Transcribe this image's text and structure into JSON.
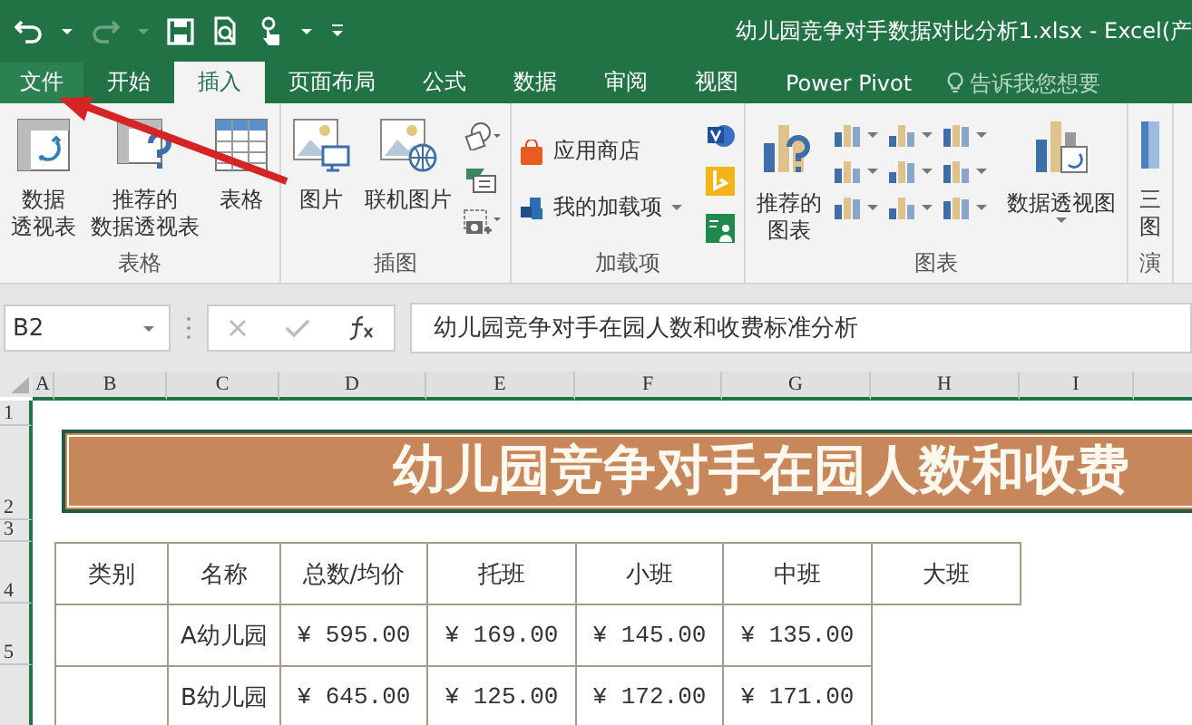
{
  "window": {
    "title": "幼儿园竞争对手数据对比分析1.xlsx - Excel(产"
  },
  "tabs": [
    {
      "label": "文件",
      "selected": false,
      "kind": "file"
    },
    {
      "label": "开始",
      "selected": false,
      "kind": "tab"
    },
    {
      "label": "插入",
      "selected": true,
      "kind": "tab"
    },
    {
      "label": "页面布局",
      "selected": false,
      "kind": "tab"
    },
    {
      "label": "公式",
      "selected": false,
      "kind": "tab"
    },
    {
      "label": "数据",
      "selected": false,
      "kind": "tab"
    },
    {
      "label": "审阅",
      "selected": false,
      "kind": "tab"
    },
    {
      "label": "视图",
      "selected": false,
      "kind": "tab"
    },
    {
      "label": "Power Pivot",
      "selected": false,
      "kind": "tab"
    }
  ],
  "tell_me": {
    "placeholder": "告诉我您想要"
  },
  "ribbon": {
    "groups": [
      {
        "label": "表格",
        "buttons": [
          {
            "kind": "pivot",
            "lines": [
              "数据",
              "透视表"
            ]
          },
          {
            "kind": "recpivot",
            "lines": [
              "推荐的",
              "数据透视表"
            ]
          },
          {
            "kind": "table",
            "lines": [
              "表格"
            ]
          }
        ]
      },
      {
        "label": "插图",
        "buttons": [
          {
            "kind": "picture",
            "lines": [
              "图片"
            ]
          },
          {
            "kind": "online",
            "lines": [
              "联机图片"
            ]
          },
          {
            "kind": "shapes"
          }
        ]
      },
      {
        "label": "加载项",
        "buttons": [
          {
            "kind": "addins"
          }
        ]
      },
      {
        "label": "图表",
        "buttons": [
          {
            "kind": "recchart",
            "lines": [
              "推荐的",
              "图表"
            ]
          },
          {
            "kind": "chartgrid"
          },
          {
            "kind": "pivotchart",
            "lines": [
              "数据透视图"
            ]
          }
        ]
      },
      {
        "label": "演",
        "buttons": [
          {
            "kind": "map",
            "lines": [
              "三",
              "图"
            ]
          }
        ]
      }
    ],
    "addins": [
      "应用商店",
      "我的加载项"
    ]
  },
  "formula_bar": {
    "name_box": "B2",
    "formula": "幼儿园竞争对手在园人数和收费标准分析"
  },
  "columns": [
    "A",
    "B",
    "C",
    "D",
    "E",
    "F",
    "G",
    "H",
    "I",
    ""
  ],
  "row_numbers": [
    "1",
    "2",
    "3",
    "4",
    "5"
  ],
  "sheet_title": "幼儿园竞争对手在园人数和收费",
  "table": {
    "columns": [
      "类别",
      "名称",
      "总数/均价",
      "托班",
      "小班",
      "中班",
      "大班"
    ],
    "rows": [
      [
        "",
        "A幼儿园",
        "¥  595.00",
        "¥  169.00",
        "¥  145.00",
        "¥  135.00"
      ],
      [
        "",
        "B幼儿园",
        "¥  645.00",
        "¥  125.00",
        "¥  172.00",
        "¥  171.00"
      ]
    ]
  }
}
